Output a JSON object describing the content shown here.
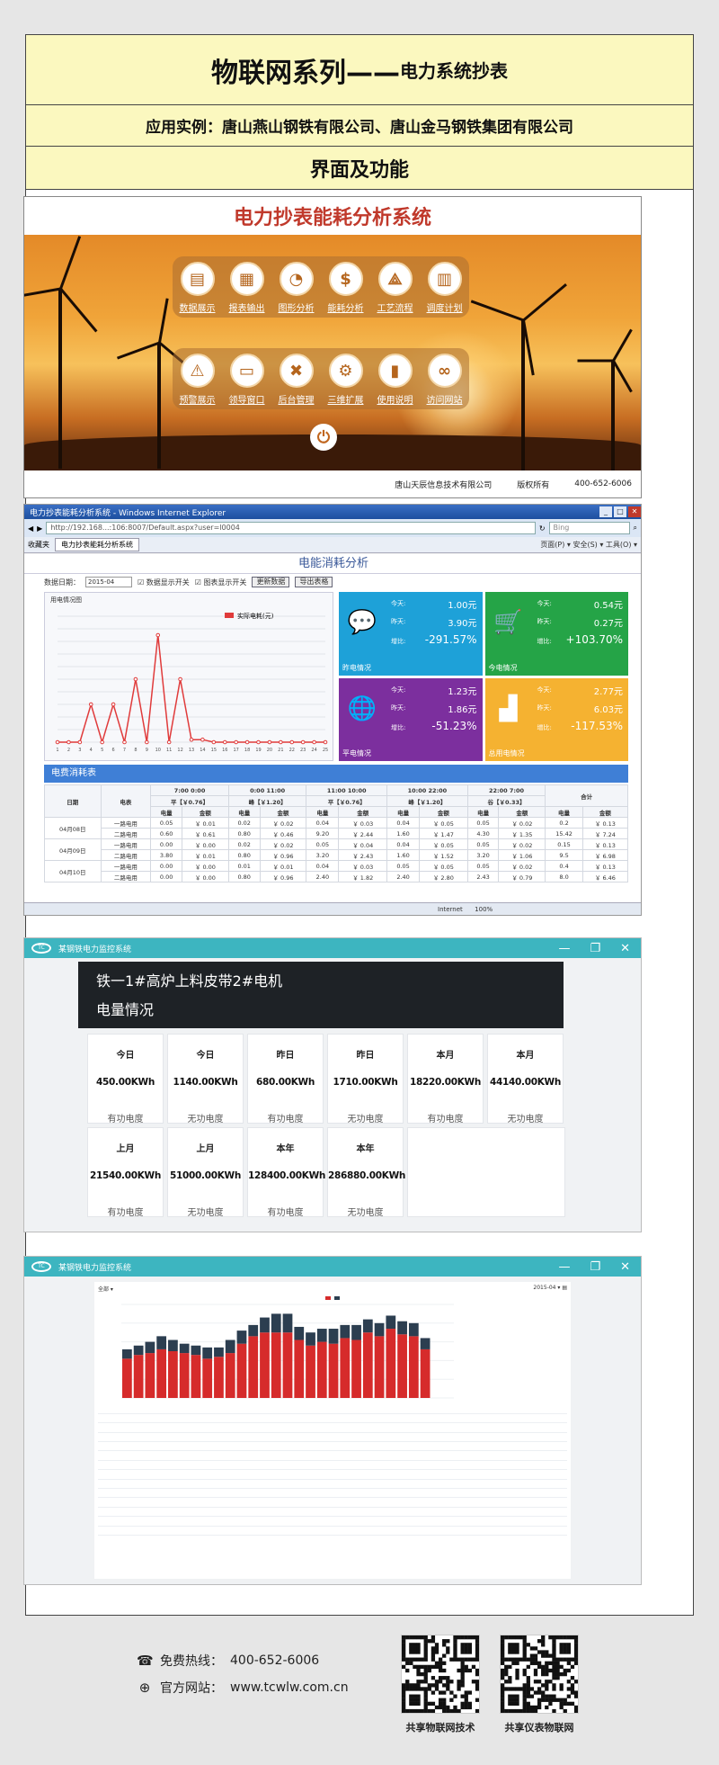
{
  "header": {
    "title_main": "物联网系列——",
    "title_sub": "电力系统抄表",
    "application": "应用实例：唐山燕山钢铁有限公司、唐山金马钢铁集团有限公司",
    "section": "界面及功能"
  },
  "panel1": {
    "title": "电力抄表能耗分析系统",
    "row1": [
      {
        "label": "数据展示",
        "icon": "monitor-icon"
      },
      {
        "label": "报表输出",
        "icon": "report-icon"
      },
      {
        "label": "图形分析",
        "icon": "pie-chart-icon"
      },
      {
        "label": "能耗分析",
        "icon": "money-icon"
      },
      {
        "label": "工艺流程",
        "icon": "compass-icon"
      },
      {
        "label": "调度计划",
        "icon": "calendar-icon"
      }
    ],
    "row2": [
      {
        "label": "预警展示",
        "icon": "alarm-icon"
      },
      {
        "label": "领导窗口",
        "icon": "laptop-icon"
      },
      {
        "label": "后台管理",
        "icon": "tools-icon"
      },
      {
        "label": "三维扩展",
        "icon": "gear-icon"
      },
      {
        "label": "使用说明",
        "icon": "book-icon"
      },
      {
        "label": "访问网站",
        "icon": "link-icon"
      }
    ],
    "footer_company": "唐山天辰信息技术有限公司",
    "footer_rights": "版权所有",
    "footer_phone": "400-652-6006"
  },
  "panel2": {
    "window_title": "电力抄表能耗分析系统 - Windows Internet Explorer",
    "url": "http://192.168...:106:8007/Default.aspx?user=l0004",
    "search_placeholder": "Bing",
    "favorites": "收藏夹",
    "tab": "电力抄表能耗分析系统",
    "toolbar_right": "页面(P) ▾  安全(S) ▾  工具(O) ▾",
    "app_title": "电能消耗分析",
    "date_label": "数据日期：",
    "date_value": "2015-04",
    "check1": "数据显示开关",
    "check2": "图表显示开关",
    "btn_refresh": "更新数据",
    "btn_export": "导出表格",
    "chart_caption": "用电情况图",
    "chart_legend": "实际电耗(元)",
    "status_text": "Internet",
    "zoom": "100%",
    "tiles": [
      {
        "name": "昨电情况",
        "today_label": "今天:",
        "today": "1.00元",
        "yest_label": "昨天:",
        "yest": "3.90元",
        "ratio_label": "增比:",
        "ratio": "-291.57%",
        "color": "#1ea1d8",
        "icon": "chat-bubble-icon"
      },
      {
        "name": "今电情况",
        "today_label": "今天:",
        "today": "0.54元",
        "yest_label": "昨天:",
        "yest": "0.27元",
        "ratio_label": "增比:",
        "ratio": "+103.70%",
        "color": "#25a447",
        "icon": "cart-icon"
      },
      {
        "name": "平电情况",
        "today_label": "今天:",
        "today": "1.23元",
        "yest_label": "昨天:",
        "yest": "1.86元",
        "ratio_label": "增比:",
        "ratio": "-51.23%",
        "color": "#7c2f9e",
        "icon": "globe-icon"
      },
      {
        "name": "总用电情况",
        "today_label": "今天:",
        "today": "2.77元",
        "yest_label": "昨天:",
        "yest": "6.03元",
        "ratio_label": "增比:",
        "ratio": "-117.53%",
        "color": "#f5b231",
        "icon": "bar-chart-icon"
      }
    ],
    "ratio_title": "电费消耗表",
    "table_head": {
      "date": "日期",
      "meter": "电表",
      "p1_time": "7:00 0:00",
      "p1_price": "平【￥0.76】",
      "p2_time": "0:00 11:00",
      "p2_price": "峰【￥1.20】",
      "p3_time": "11:00 10:00",
      "p3_price": "平【￥0.76】",
      "p4_time": "10:00 22:00",
      "p4_price": "峰【￥1.20】",
      "p5_time": "22:00 7:00",
      "p5_price": "谷【￥0.33】",
      "total": "合计",
      "qty": "电量",
      "amount": "金额"
    },
    "rows": [
      {
        "date": "04月08日",
        "items": [
          [
            "一路电用",
            "0.05",
            "￥ 0.01",
            "0.02",
            "￥ 0.02",
            "0.04",
            "￥ 0.03",
            "0.04",
            "￥ 0.05",
            "0.05",
            "￥ 0.02",
            "0.2",
            "￥ 0.13"
          ],
          [
            "二路电用",
            "0.60",
            "￥ 0.61",
            "0.80",
            "￥ 0.46",
            "9.20",
            "￥ 2.44",
            "1.60",
            "￥ 1.47",
            "4.30",
            "￥ 1.35",
            "15.42",
            "￥ 7.24"
          ]
        ]
      },
      {
        "date": "04月09日",
        "items": [
          [
            "一路电用",
            "0.00",
            "￥ 0.00",
            "0.02",
            "￥ 0.02",
            "0.05",
            "￥ 0.04",
            "0.04",
            "￥ 0.05",
            "0.05",
            "￥ 0.02",
            "0.15",
            "￥ 0.13"
          ],
          [
            "二路电用",
            "3.80",
            "￥ 0.01",
            "0.80",
            "￥ 0.96",
            "3.20",
            "￥ 2.43",
            "1.60",
            "￥ 1.52",
            "3.20",
            "￥ 1.06",
            "9.5",
            "￥ 6.98"
          ]
        ]
      },
      {
        "date": "04月10日",
        "items": [
          [
            "一路电用",
            "0.00",
            "￥ 0.00",
            "0.01",
            "￥ 0.01",
            "0.04",
            "￥ 0.03",
            "0.05",
            "￥ 0.05",
            "0.05",
            "￥ 0.02",
            "0.4",
            "￥ 0.13"
          ],
          [
            "二路电用",
            "0.00",
            "￥ 0.00",
            "0.80",
            "￥ 0.96",
            "2.40",
            "￥ 1.82",
            "2.40",
            "￥ 2.80",
            "2.43",
            "￥ 0.79",
            "8.0",
            "￥ 6.46"
          ]
        ]
      }
    ]
  },
  "panel3": {
    "window_title": "某钢铁电力监控系统",
    "line_name": "铁一1#高炉上料皮带2#电机",
    "section_title": "电量情况",
    "cards_row1": [
      {
        "period": "今日",
        "value": "450.00KWh",
        "type": "有功电度"
      },
      {
        "period": "今日",
        "value": "1140.00KWh",
        "type": "无功电度"
      },
      {
        "period": "昨日",
        "value": "680.00KWh",
        "type": "有功电度"
      },
      {
        "period": "昨日",
        "value": "1710.00KWh",
        "type": "无功电度"
      },
      {
        "period": "本月",
        "value": "18220.00KWh",
        "type": "有功电度"
      },
      {
        "period": "本月",
        "value": "44140.00KWh",
        "type": "无功电度"
      }
    ],
    "cards_row2": [
      {
        "period": "上月",
        "value": "21540.00KWh",
        "type": "有功电度"
      },
      {
        "period": "上月",
        "value": "51000.00KWh",
        "type": "无功电度"
      },
      {
        "period": "本年",
        "value": "128400.00KWh",
        "type": "有功电度"
      },
      {
        "period": "本年",
        "value": "286880.00KWh",
        "type": "无功电度"
      }
    ]
  },
  "panel4": {
    "window_title": "某钢铁电力监控系统",
    "select_label": "全部 ▾",
    "select_right": "2015-04 ▾  ▤"
  },
  "footer": {
    "hotline_label": "免费热线：",
    "hotline": "400-652-6006",
    "site_label": "官方网站：",
    "site": "www.tcwlw.com.cn",
    "qr1_label": "共享物联网技术",
    "qr2_label": "共享仪表物联网"
  },
  "chart_data": {
    "type": "line",
    "title": "",
    "series": [
      {
        "name": "实际电耗(元)",
        "color": "#e03b3b",
        "values": [
          0,
          0,
          0,
          3,
          0,
          3,
          0,
          5,
          0,
          8.5,
          0,
          5,
          0.2,
          0.2,
          0,
          0,
          0,
          0,
          0,
          0,
          0,
          0,
          0,
          0,
          0
        ]
      }
    ],
    "x": [
      1,
      2,
      3,
      4,
      5,
      6,
      7,
      8,
      9,
      10,
      11,
      12,
      13,
      14,
      15,
      16,
      17,
      18,
      19,
      20,
      21,
      22,
      23,
      24,
      25
    ],
    "ylim": [
      0,
      10
    ],
    "grid": true
  },
  "bar_data": {
    "type": "bar",
    "series": [
      {
        "color": "#d62b2b",
        "values": [
          42,
          46,
          48,
          52,
          50,
          48,
          46,
          42,
          44,
          48,
          58,
          66,
          70,
          70,
          70,
          62,
          56,
          60,
          58,
          64,
          62,
          70,
          66,
          74,
          68,
          66,
          52,
          0,
          0
        ]
      },
      {
        "color": "#2c3e50",
        "values": [
          10,
          10,
          12,
          14,
          12,
          10,
          10,
          12,
          10,
          14,
          14,
          12,
          16,
          20,
          20,
          14,
          14,
          14,
          16,
          14,
          16,
          14,
          14,
          14,
          14,
          14,
          12,
          0,
          0
        ]
      }
    ],
    "ylim": [
      0,
      100
    ]
  }
}
